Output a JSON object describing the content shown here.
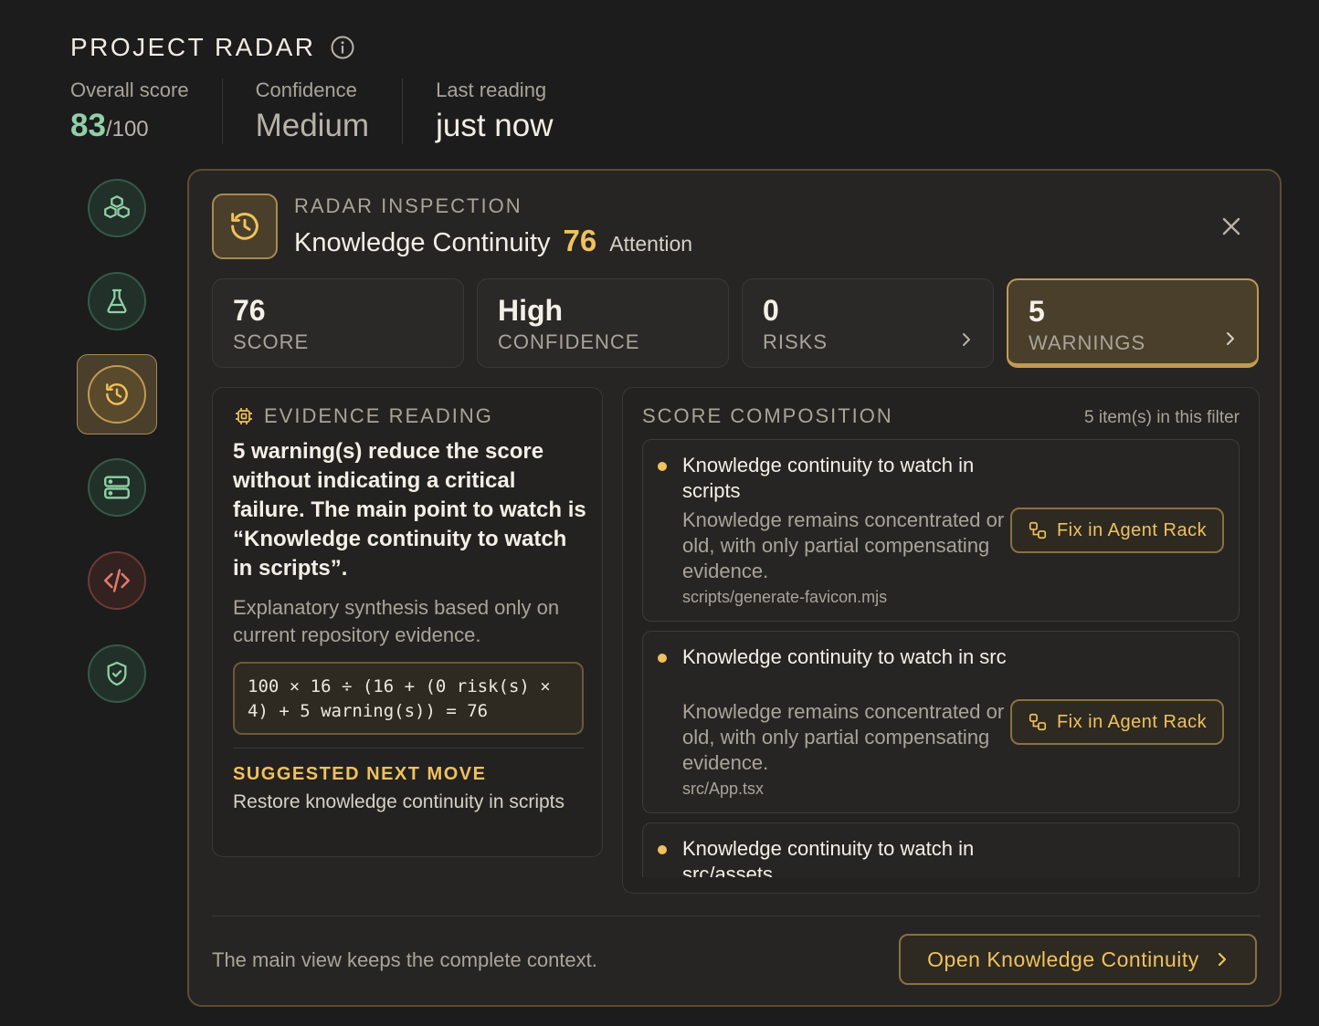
{
  "header": {
    "title": "PROJECT RADAR",
    "stats": {
      "overall_label": "Overall score",
      "overall_value": "83",
      "overall_max": "/100",
      "confidence_label": "Confidence",
      "confidence_value": "Medium",
      "last_label": "Last reading",
      "last_value": "just now"
    }
  },
  "nav": {
    "items": [
      {
        "icon": "cubes-icon"
      },
      {
        "icon": "flask-icon"
      },
      {
        "icon": "history-icon",
        "active": true
      },
      {
        "icon": "server-icon"
      },
      {
        "icon": "code-icon"
      },
      {
        "icon": "shield-check-icon"
      }
    ]
  },
  "panel": {
    "eyebrow": "RADAR INSPECTION",
    "title": "Knowledge Continuity",
    "score": "76",
    "status": "Attention",
    "metrics": [
      {
        "value": "76",
        "label": "SCORE"
      },
      {
        "value": "High",
        "label": "CONFIDENCE"
      },
      {
        "value": "0",
        "label": "RISKS"
      },
      {
        "value": "5",
        "label": "WARNINGS"
      }
    ],
    "evidence": {
      "heading": "EVIDENCE READING",
      "body": "5 warning(s) reduce the score without indicating a critical failure. The main point to watch is “Knowledge continuity to watch in scripts”.",
      "sub": "Explanatory synthesis based only on current repository evidence.",
      "formula": "100 × 16 ÷ (16 + (0 risk(s) × 4) + 5 warning(s)) = 76",
      "next_label": "SUGGESTED NEXT MOVE",
      "next_text": "Restore knowledge continuity in scripts"
    },
    "composition": {
      "heading": "SCORE COMPOSITION",
      "count": "5 item(s) in this filter",
      "fix_label": "Fix in Agent Rack",
      "items": [
        {
          "title": "Knowledge continuity to watch in scripts",
          "desc": "Knowledge remains concentrated or old, with only partial compensating evidence.",
          "path": "scripts/generate-favicon.mjs"
        },
        {
          "title": "Knowledge continuity to watch in src",
          "desc": "Knowledge remains concentrated or old, with only partial compensating evidence.",
          "path": "src/App.tsx"
        },
        {
          "title": "Knowledge continuity to watch in src/assets",
          "desc": "",
          "path": ""
        }
      ]
    },
    "footer": {
      "text": "The main view keeps the complete context.",
      "open_label": "Open Knowledge Continuity"
    }
  },
  "colors": {
    "accent_gold": "#f0c15e",
    "score_green": "#8fd0a6",
    "background": "#1c1c1c"
  }
}
